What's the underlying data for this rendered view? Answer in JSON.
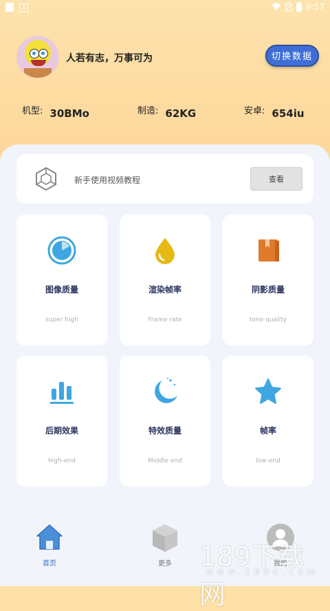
{
  "status_bar": {
    "time": "9:57"
  },
  "header": {
    "motto": "人若有志，万事可为",
    "switch_button": "切换数据",
    "specs": [
      {
        "label": "机型:",
        "value": "30BMo"
      },
      {
        "label": "制造:",
        "value": "62KG"
      },
      {
        "label": "安卓:",
        "value": "654iu"
      }
    ]
  },
  "tutorial": {
    "label": "新手使用视频教程",
    "button": "查看"
  },
  "cards": [
    {
      "title": "图像质量",
      "subtitle": "super high",
      "icon": "stopwatch-icon",
      "color": "#3ea6e0"
    },
    {
      "title": "渲染帧率",
      "subtitle": "Frame rate",
      "icon": "drop-icon",
      "color": "#e5b814"
    },
    {
      "title": "阴影质量",
      "subtitle": "tone quality",
      "icon": "book-icon",
      "color": "#e07a2c"
    },
    {
      "title": "后期效果",
      "subtitle": "high-end",
      "icon": "bar-chart-icon",
      "color": "#3ea6e0"
    },
    {
      "title": "特效质量",
      "subtitle": "Middle end",
      "icon": "moon-icon",
      "color": "#3ea6e0"
    },
    {
      "title": "帧率",
      "subtitle": "low-end",
      "icon": "star-icon",
      "color": "#3ea6e0"
    }
  ],
  "tabs": [
    {
      "label": "首页",
      "icon": "home-icon",
      "active": true
    },
    {
      "label": "更多",
      "icon": "cube-icon",
      "active": false
    },
    {
      "label": "我的",
      "icon": "user-icon",
      "active": false
    }
  ],
  "watermark": {
    "text": "189下载网",
    "url": "www.189d.com"
  }
}
